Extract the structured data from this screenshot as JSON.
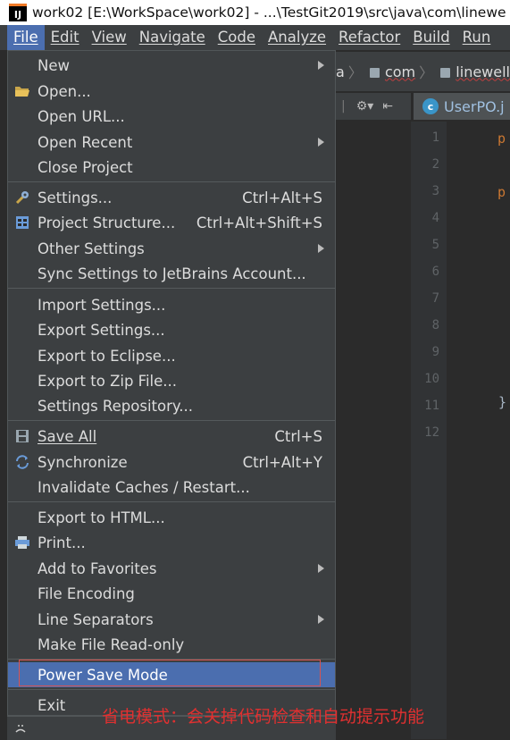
{
  "window": {
    "title": "work02 [E:\\WorkSpace\\work02] - ...\\TestGit2019\\src\\java\\com\\linewe",
    "app_icon_text": "IJ"
  },
  "menubar": [
    "File",
    "Edit",
    "View",
    "Navigate",
    "Code",
    "Analyze",
    "Refactor",
    "Build",
    "Run"
  ],
  "breadcrumb": {
    "partial": "a",
    "items": [
      "com",
      "linewell"
    ]
  },
  "editor": {
    "tab_label": "UserPO.j",
    "tab_icon_letter": "c",
    "line_numbers": [
      "1",
      "2",
      "3",
      "4",
      "5",
      "6",
      "7",
      "8",
      "9",
      "10",
      "11",
      "12"
    ],
    "line1_char": "p",
    "line3_char": "p",
    "line11_char": "}"
  },
  "file_menu": {
    "new": "New",
    "open": "Open...",
    "open_url": "Open URL...",
    "open_recent": "Open Recent",
    "close_project": "Close Project",
    "settings": "Settings...",
    "settings_sc": "Ctrl+Alt+S",
    "project_structure": "Project Structure...",
    "project_structure_sc": "Ctrl+Alt+Shift+S",
    "other_settings": "Other Settings",
    "sync_settings": "Sync Settings to JetBrains Account...",
    "import_settings": "Import Settings...",
    "export_settings": "Export Settings...",
    "export_eclipse": "Export to Eclipse...",
    "export_zip": "Export to Zip File...",
    "settings_repo": "Settings Repository...",
    "save_all": "Save All",
    "save_all_sc": "Ctrl+S",
    "synchronize": "Synchronize",
    "synchronize_sc": "Ctrl+Alt+Y",
    "invalidate": "Invalidate Caches / Restart...",
    "export_html": "Export to HTML...",
    "print": "Print...",
    "add_favorites": "Add to Favorites",
    "file_encoding": "File Encoding",
    "line_separators": "Line Separators",
    "make_readonly": "Make File Read-only",
    "power_save": "Power Save Mode",
    "exit": "Exit"
  },
  "annotation": "省电模式：会关掉代码检查和自动提示功能",
  "colors": {
    "menu_bg": "#3c3f41",
    "highlight": "#4b6eaf",
    "annotation_red": "#e03030"
  }
}
